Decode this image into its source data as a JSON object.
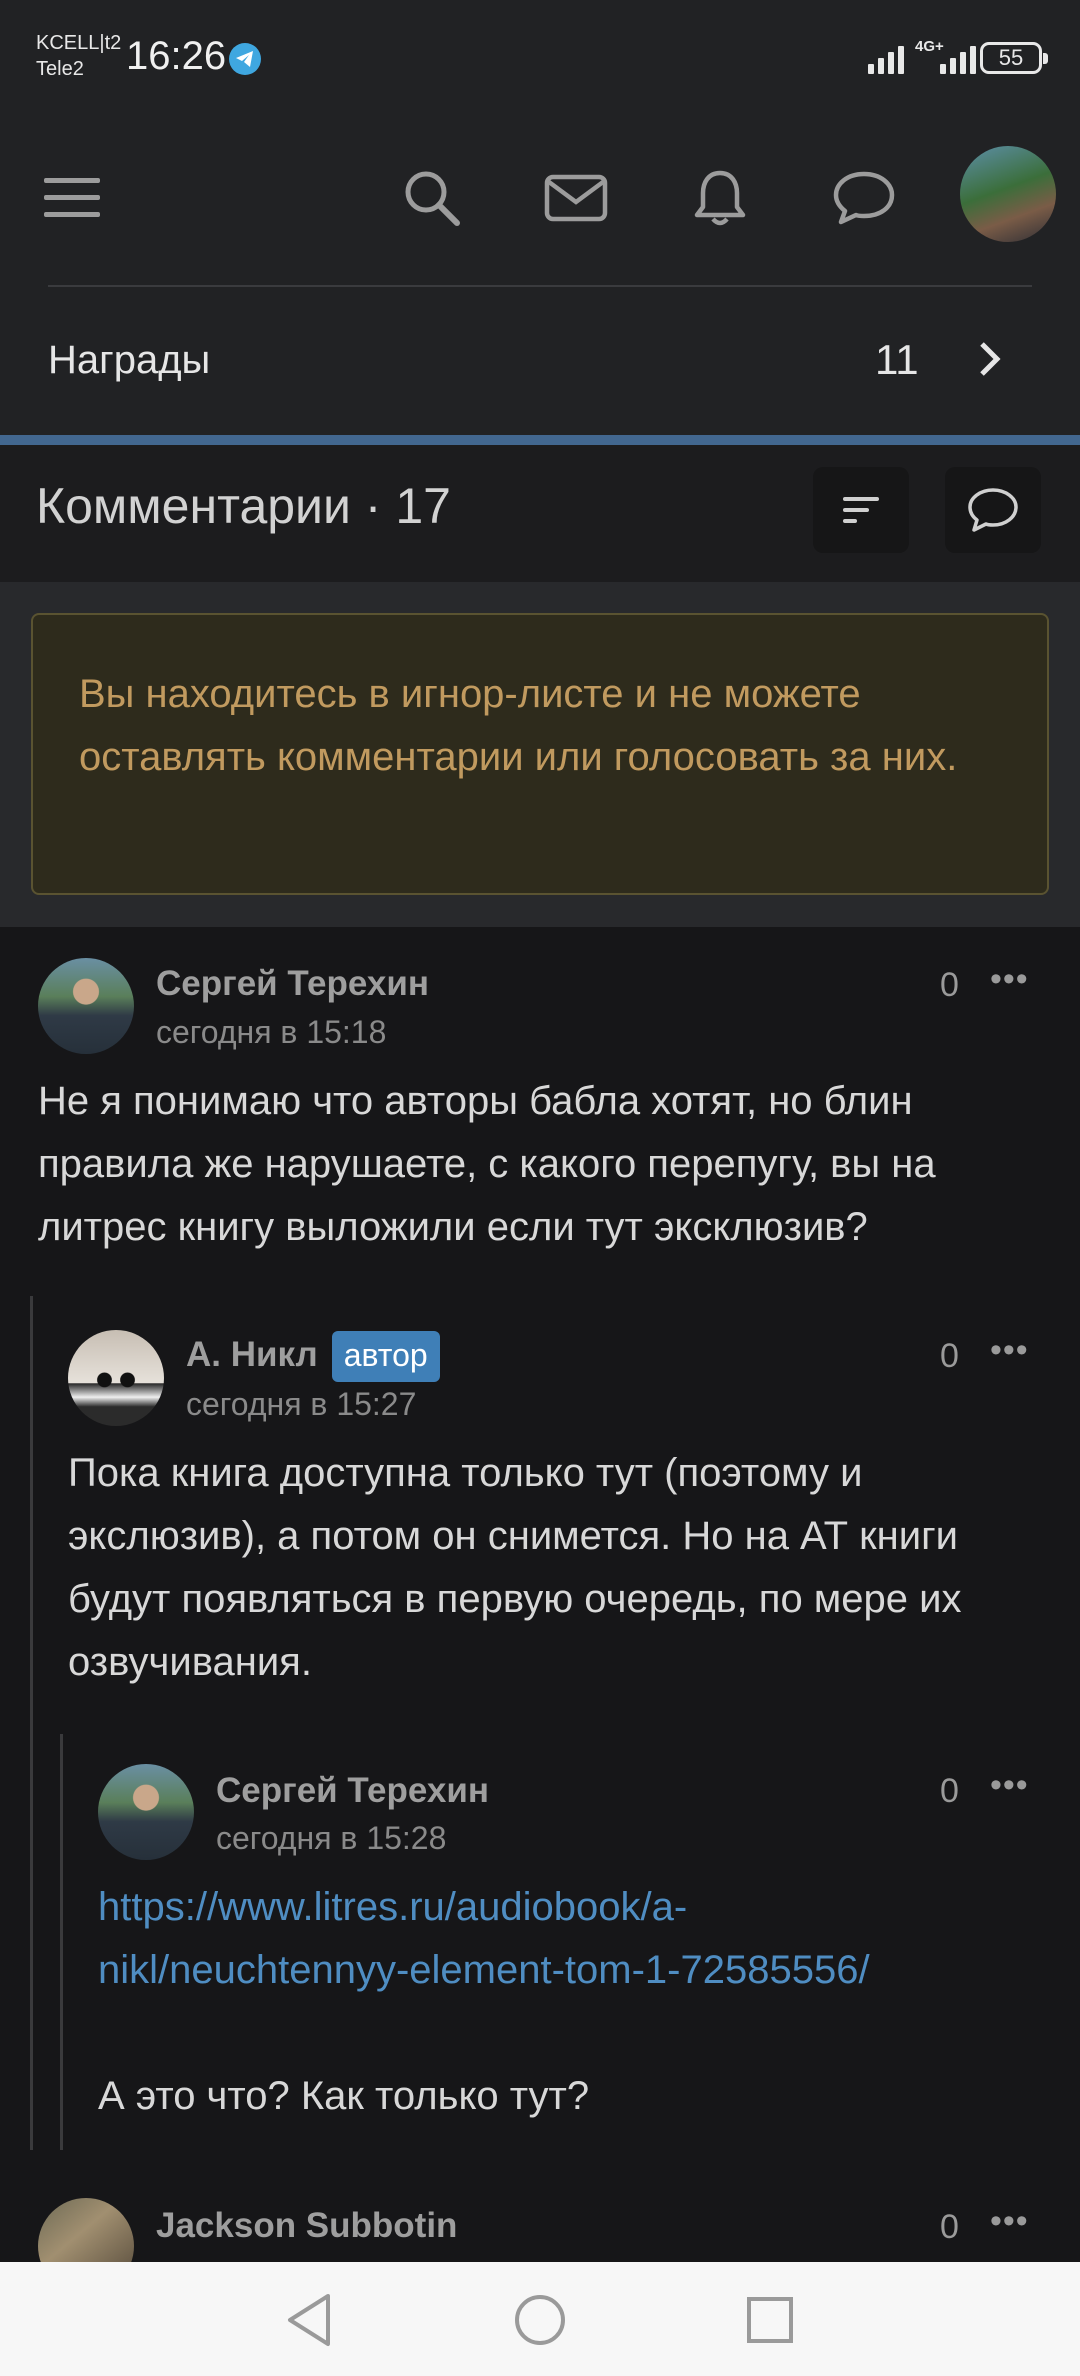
{
  "status_bar": {
    "carrier_1": "KCELL|t2",
    "carrier_2": "Tele2",
    "time": "16:26",
    "network": "4G+",
    "battery": "55",
    "icons": [
      "telegram-icon",
      "signal-icon",
      "battery-icon"
    ]
  },
  "header": {
    "icons": [
      "menu-icon",
      "search-icon",
      "mail-icon",
      "bell-icon",
      "chat-bubble-icon",
      "avatar"
    ]
  },
  "rewards": {
    "label": "Награды",
    "count": "11"
  },
  "comments_section": {
    "title": "Комментарии · 17",
    "buttons": [
      "sort-icon",
      "comment-icon"
    ]
  },
  "notice": {
    "text": "Вы находитесь в игнор-листе и не можете оставлять комментарии или голосовать за них."
  },
  "comments": [
    {
      "author": "Сергей Терехин",
      "date": "сегодня в 15:18",
      "score": "0",
      "text": "Не я понимаю что авторы бабла хотят, но блин правила же нарушаете, с какого перепугу, вы на литрес книгу выложили если тут эксклюзив?"
    },
    {
      "author": "А. Никл",
      "badge": "автор",
      "date": "сегодня в 15:27",
      "score": "0",
      "text": "Пока книга доступна только тут (поэтому и экслюзив), а потом он снимется. Но на АТ книги будут появляться в первую очередь, по мере их озвучивания."
    },
    {
      "author": "Сергей Терехин",
      "date": "сегодня в 15:28",
      "score": "0",
      "link": "https://www.litres.ru/audiobook/a-nikl/neuchtennyy-element-tom-1-72585556/",
      "link_line_1": "https://www.litres.ru/audiobook/a-",
      "link_line_2": "nikl/neuchtennyy-element-tom-1-72585556/",
      "text": "А это что? Как только тут?"
    },
    {
      "author": "Jackson Subbotin",
      "score": "0"
    }
  ],
  "more_label": "•••",
  "colors": {
    "background": "#161618",
    "header": "#212224",
    "accent_line": "#42678f",
    "notice_text": "#c19a5f",
    "badge": "#3f7fb7",
    "link": "#4f8dc2"
  }
}
